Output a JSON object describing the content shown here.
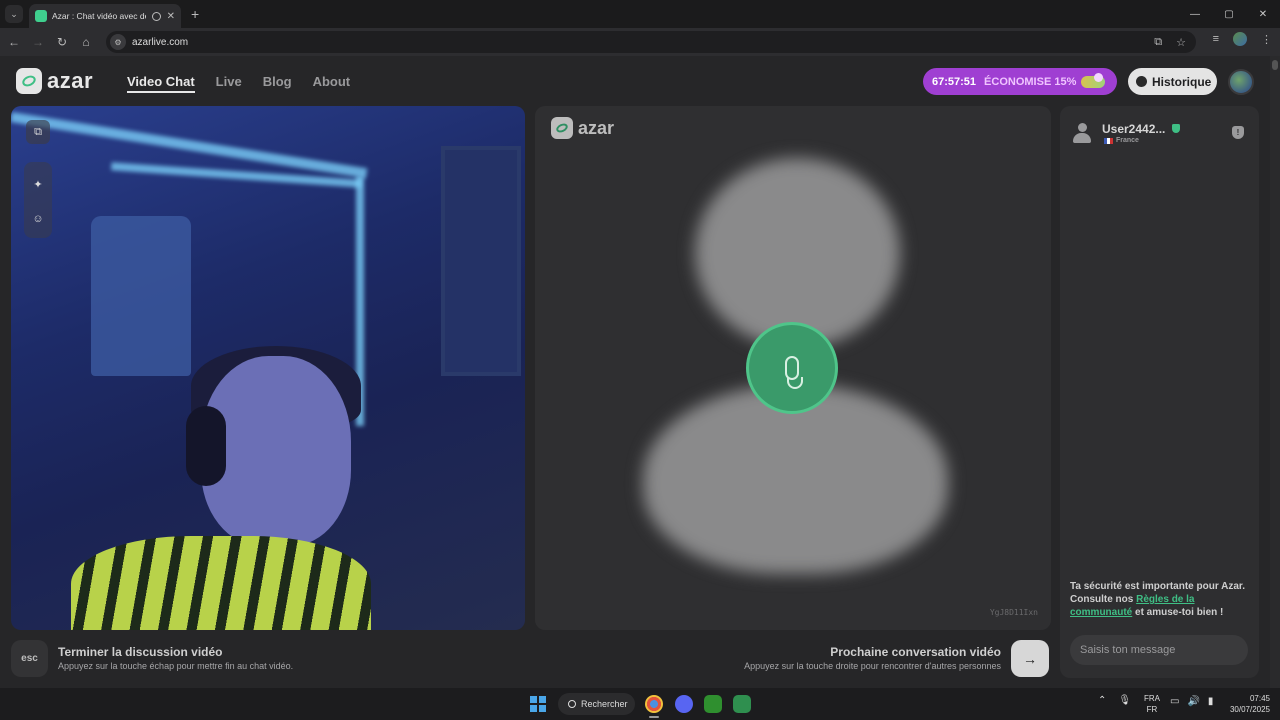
{
  "browser": {
    "tab_title": "Azar : Chat vidéo avec de n",
    "tab_close": "✕",
    "new_tab": "+",
    "tab_menu": "⌄",
    "url": "azarlive.com",
    "window_controls": {
      "minimize": "—",
      "maximize": "▢",
      "close": "✕"
    },
    "nav": {
      "back": "←",
      "forward": "→",
      "reload": "↻",
      "home": "⌂"
    }
  },
  "header": {
    "logo_text": "azar",
    "nav": [
      {
        "label": "Video Chat",
        "active": true
      },
      {
        "label": "Live",
        "active": false
      },
      {
        "label": "Blog",
        "active": false
      },
      {
        "label": "About",
        "active": false
      }
    ],
    "promo": {
      "timer": "67:57:51",
      "label": "ÉCONOMISE 15%"
    },
    "history_label": "Historique"
  },
  "partner": {
    "logo_text": "azar",
    "id_text": "YgJ8D11Ixn"
  },
  "chat": {
    "username": "User2442...",
    "country": "France",
    "safety_text_1": "Ta sécurité est importante pour Azar. Consulte nos ",
    "safety_link": "Règles de la communauté",
    "safety_text_2": " et amuse-toi bien !",
    "input_placeholder": "Saisis ton message",
    "report_glyph": "!"
  },
  "controls": {
    "esc_label": "esc",
    "end_title": "Terminer la discussion vidéo",
    "end_sub": "Appuyez sur la touche échap pour mettre fin au chat vidéo.",
    "next_title": "Prochaine conversation vidéo",
    "next_sub": "Appuyez sur la touche droite pour rencontrer d'autres personnes",
    "next_glyph": "→"
  },
  "self_video": {
    "buttons": {
      "expand": "⧉",
      "effects": "✦",
      "sticker": "☺"
    }
  },
  "taskbar": {
    "search_label": "Rechercher",
    "lang_top": "FRA",
    "lang_bottom": "FR",
    "time": "07:45",
    "date": "30/07/2025"
  },
  "colors": {
    "accent_green": "#3fbf85",
    "promo_purple": "#9f3fd2",
    "page_bg": "#262628"
  }
}
